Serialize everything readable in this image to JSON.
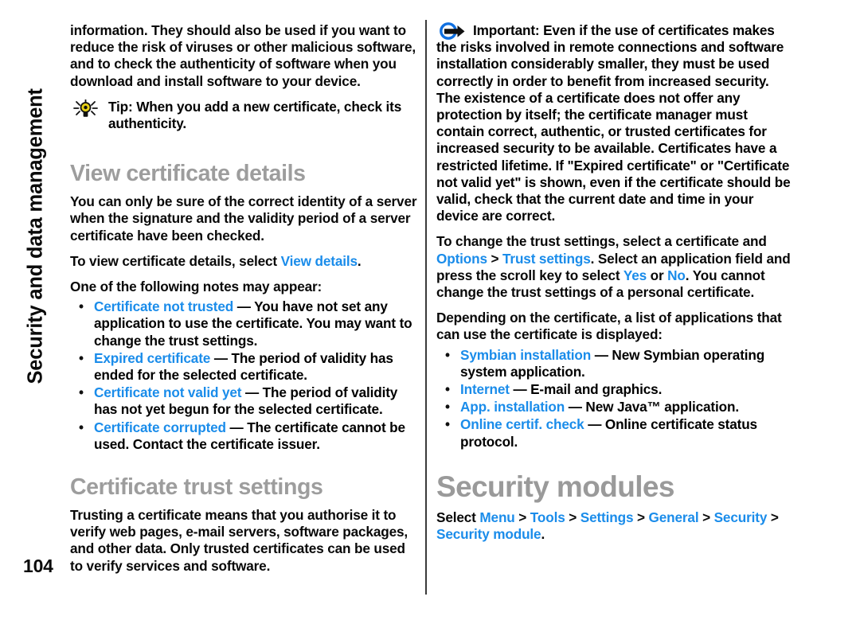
{
  "page": {
    "folio": "104",
    "running_head": "Security and data management",
    "divider_color": "#3a3a3a",
    "link_color": "#1a8cea",
    "heading_color": "#9a9a9a",
    "text_color": "#080808"
  },
  "left_column": {
    "continued_paragraph": "information. They should also be used if you want to reduce the risk of viruses or other malicious software, and to check the authenticity of software when you download and install software to your device.",
    "tip_note": {
      "icon": "lightbulb-icon",
      "label": "Tip:",
      "text": " When you add a new certificate, check its authenticity."
    },
    "heading_view_certificate_details": "View certificate details",
    "paragraph_identity": "You can only be sure of the correct identity of a server when the signature and the validity period of a server certificate have been checked.",
    "paragraph_view_details_pre": "To view certificate details, select ",
    "paragraph_view_details_link": "View details",
    "paragraph_view_details_post": ".",
    "paragraph_notes_intro": "One of the following notes may appear:",
    "notes_list": [
      {
        "term": "Certificate not trusted",
        "description": " — You have not set any application to use the certificate. You may want to change the trust settings."
      },
      {
        "term": "Expired certificate",
        "description": " — The period of validity has ended for the selected certificate."
      },
      {
        "term": "Certificate not valid yet",
        "description": " — The period of validity has not yet begun for the selected certificate."
      },
      {
        "term": "Certificate corrupted",
        "description": " — The certificate cannot be used. Contact the certificate issuer."
      }
    ],
    "heading_certificate_trust_settings": "Certificate trust settings",
    "paragraph_trusting": "Trusting a certificate means that you authorise it to verify web pages, e-mail servers, software packages, and other data. Only trusted certificates can be used to verify services and software."
  },
  "right_column": {
    "important_note": {
      "icon": "important-arrow-icon",
      "label": "Important:",
      "text": " Even if the use of certificates makes the risks involved in remote connections and software installation considerably smaller, they must be used correctly in order to benefit from increased security. The existence of a certificate does not offer any protection by itself; the certificate manager must contain correct, authentic, or trusted certificates for increased security to be available. Certificates have a restricted lifetime. If \"Expired certificate\" or \"Certificate not valid yet\" is shown, even if the certificate should be valid, check that the current date and time in your device are correct."
    },
    "trust_settings_paragraph": {
      "part1": "To change the trust settings, select a certificate and ",
      "link_options": "Options",
      "sep1": " > ",
      "link_trust_settings": "Trust settings",
      "part2": ". Select an application field and press the scroll key to select ",
      "link_yes": "Yes",
      "part3": " or ",
      "link_no": "No",
      "part4": ". You cannot change the trust settings of a personal certificate."
    },
    "applications_intro": "Depending on the certificate, a list of applications that can use the certificate is displayed:",
    "applications_list": [
      {
        "term": "Symbian installation",
        "description": " — New Symbian operating system application."
      },
      {
        "term": "Internet",
        "description": " — E-mail and graphics."
      },
      {
        "term": "App. installation",
        "description": " — New Java™ application."
      },
      {
        "term": "Online certif. check",
        "description": " — Online certificate status protocol."
      }
    ],
    "heading_security_modules": "Security modules",
    "select_path": {
      "prefix": "Select ",
      "items": [
        "Menu",
        "Tools",
        "Settings",
        "General",
        "Security",
        "Security module"
      ],
      "separator": " > ",
      "terminator": "."
    }
  }
}
